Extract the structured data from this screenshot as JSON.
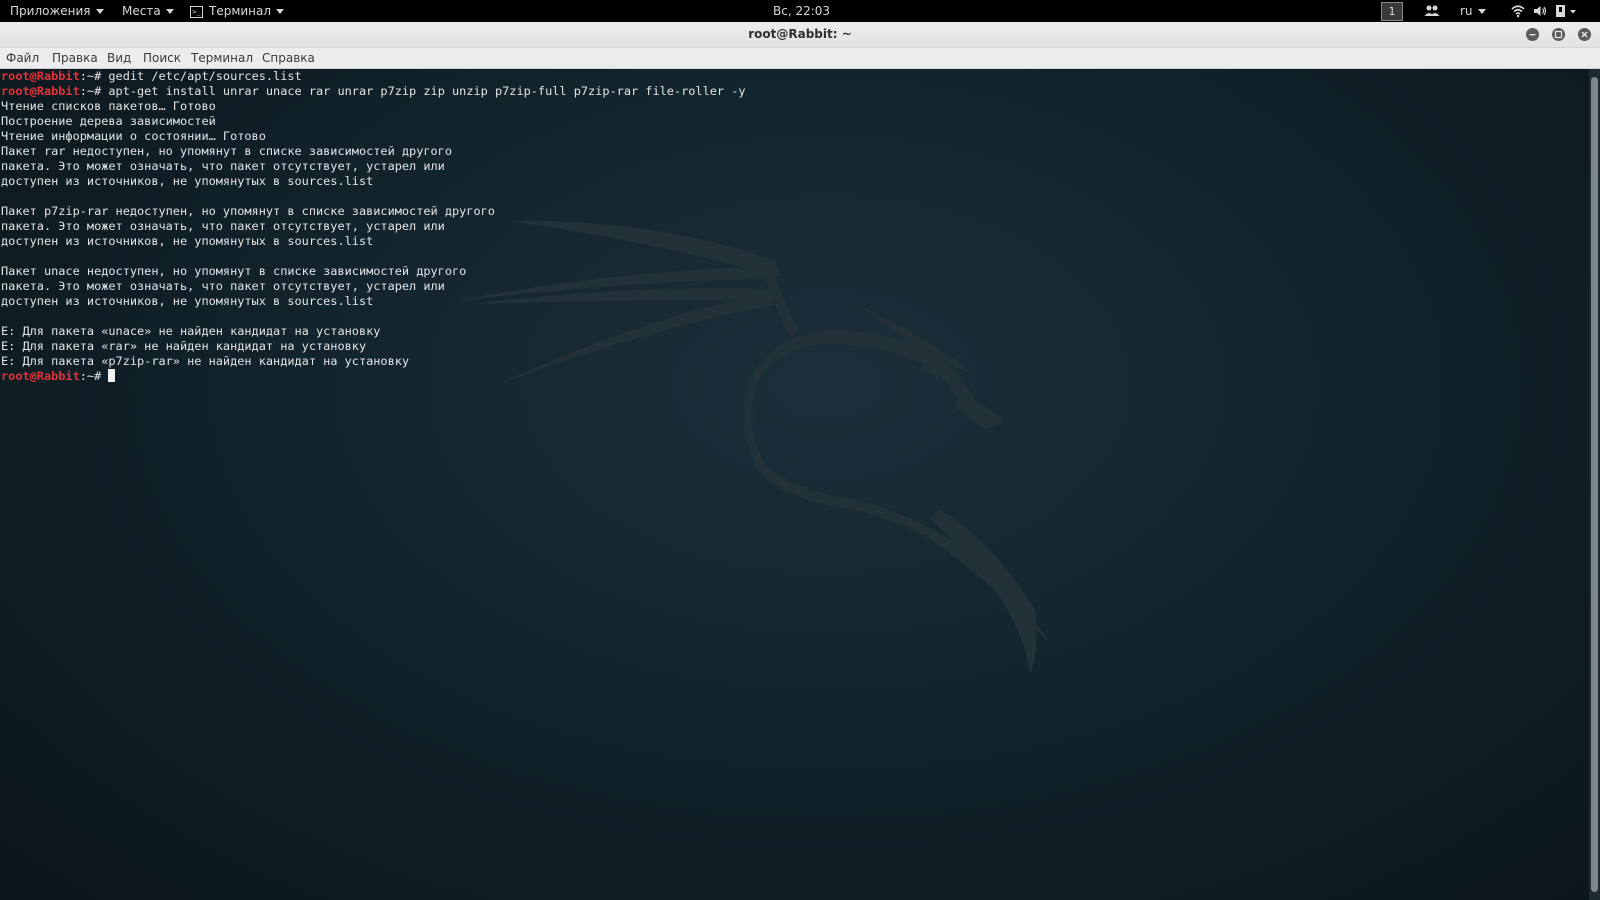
{
  "top_panel": {
    "applications_label": "Приложения",
    "places_label": "Места",
    "terminal_label": "Терминал",
    "clock": "Вс, 22:03",
    "workspace_number": "1",
    "keyboard_layout": "ru"
  },
  "window": {
    "title": "root@Rabbit: ~"
  },
  "menubar": {
    "items": [
      "Файл",
      "Правка",
      "Вид",
      "Поиск",
      "Терминал",
      "Справка"
    ]
  },
  "terminal": {
    "prompt_user": "root@Rabbit",
    "prompt_sep": ":~# ",
    "lines": [
      {
        "prompt": true,
        "text": "gedit /etc/apt/sources.list"
      },
      {
        "prompt": true,
        "text": "apt-get install unrar unace rar unrar p7zip zip unzip p7zip-full p7zip-rar file-roller -y"
      },
      {
        "prompt": false,
        "text": "Чтение списков пакетов… Готово"
      },
      {
        "prompt": false,
        "text": "Построение дерева зависимостей"
      },
      {
        "prompt": false,
        "text": "Чтение информации о состоянии… Готово"
      },
      {
        "prompt": false,
        "text": "Пакет rar недоступен, но упомянут в списке зависимостей другого"
      },
      {
        "prompt": false,
        "text": "пакета. Это может означать, что пакет отсутствует, устарел или"
      },
      {
        "prompt": false,
        "text": "доступен из источников, не упомянутых в sources.list"
      },
      {
        "prompt": false,
        "text": ""
      },
      {
        "prompt": false,
        "text": "Пакет p7zip-rar недоступен, но упомянут в списке зависимостей другого"
      },
      {
        "prompt": false,
        "text": "пакета. Это может означать, что пакет отсутствует, устарел или"
      },
      {
        "prompt": false,
        "text": "доступен из источников, не упомянутых в sources.list"
      },
      {
        "prompt": false,
        "text": ""
      },
      {
        "prompt": false,
        "text": "Пакет unace недоступен, но упомянут в списке зависимостей другого"
      },
      {
        "prompt": false,
        "text": "пакета. Это может означать, что пакет отсутствует, устарел или"
      },
      {
        "prompt": false,
        "text": "доступен из источников, не упомянутых в sources.list"
      },
      {
        "prompt": false,
        "text": ""
      },
      {
        "prompt": false,
        "text": "E: Для пакета «unace» не найден кандидат на установку"
      },
      {
        "prompt": false,
        "text": "E: Для пакета «rar» не найден кандидат на установку"
      },
      {
        "prompt": false,
        "text": "E: Для пакета «p7zip-rar» не найден кандидат на установку"
      },
      {
        "prompt": true,
        "text": "",
        "cursor": true
      }
    ]
  },
  "colors": {
    "prompt_user": "#e0333a",
    "terminal_text": "#e4e4e4",
    "terminal_bg": "#142731",
    "panel_bg": "#000000",
    "titlebar_bg": "#e8e8e8"
  },
  "icons": {
    "terminal_app": "terminal-icon",
    "users": "users-icon",
    "wifi": "wifi-icon",
    "volume": "volume-icon",
    "power": "power-icon",
    "minimize": "minimize-icon",
    "maximize": "maximize-icon",
    "close": "close-icon",
    "wallpaper": "kali-dragon-logo"
  }
}
